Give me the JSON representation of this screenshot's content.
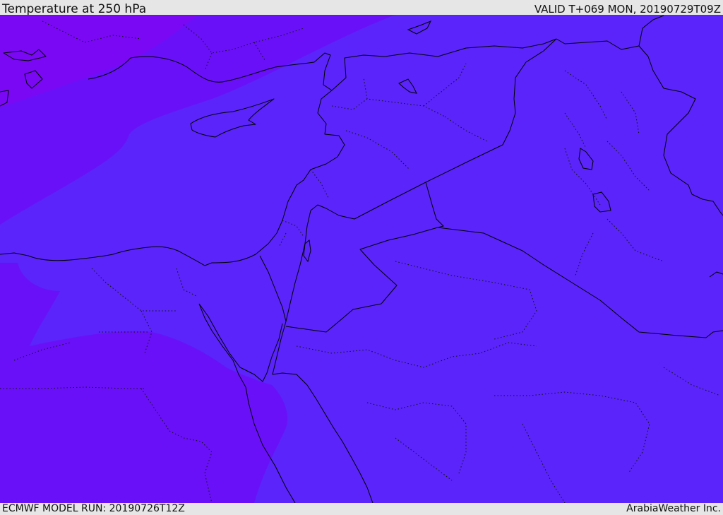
{
  "header": {
    "title": "Temperature at 250 hPa",
    "valid_time": "VALID T+069 MON, 20190729T09Z"
  },
  "footer": {
    "model_run": "ECMWF MODEL RUN: 20190726T12Z",
    "credit": "ArabiaWeather Inc."
  },
  "colors": {
    "band_coldest": "#7a08f4",
    "band_cold": "#6a10f8",
    "band_mid": "#5a24fa",
    "boundary_line": "#000000",
    "frame_bar": "#e6e6e6"
  }
}
